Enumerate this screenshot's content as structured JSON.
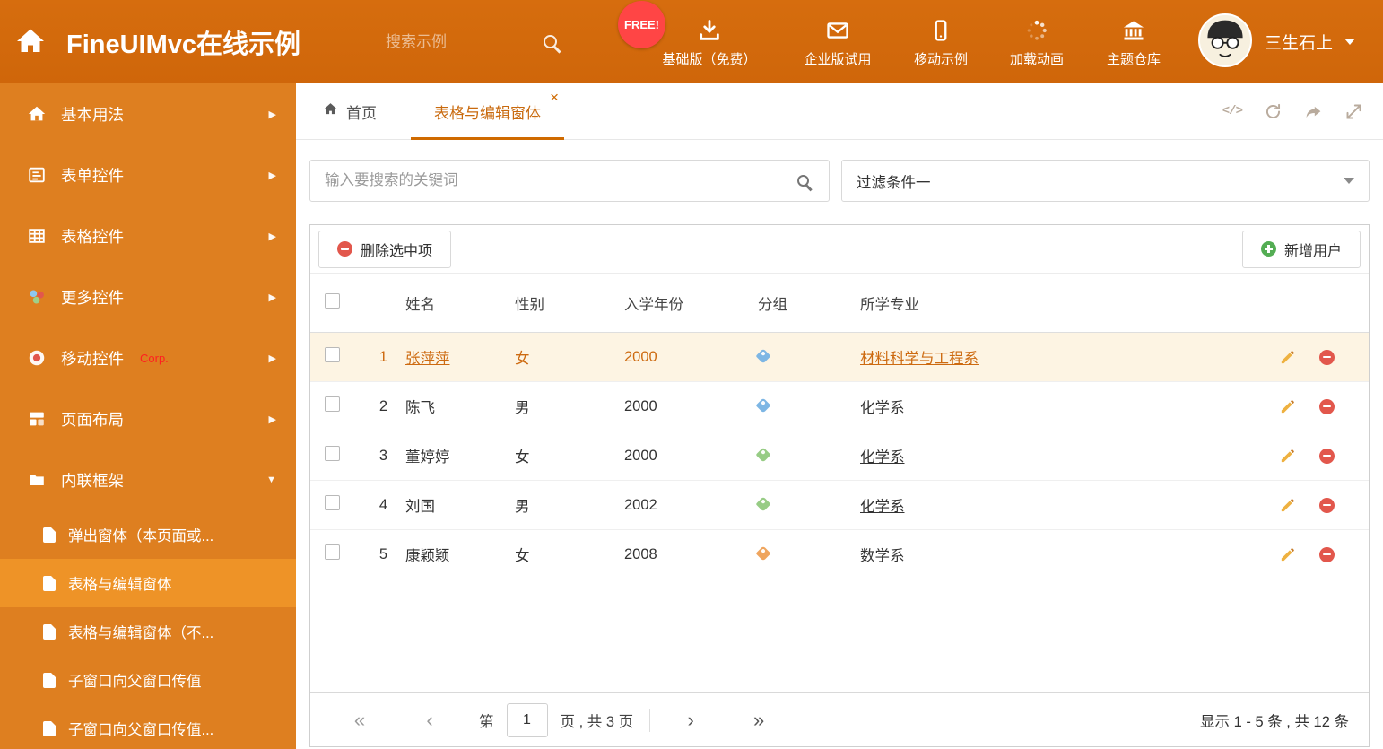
{
  "colors": {
    "header_bg": "#d2690b",
    "sidebar_bg": "#de7f20",
    "sidebar_active_bg": "#ee9327",
    "accent": "#cd6a10",
    "row_highlight_bg": "#fdf4e3",
    "danger": "#e2574c",
    "success": "#54ad54",
    "free_badge_bg": "#ff4545",
    "tag_blue": "#7db6e4",
    "tag_green": "#97cc85",
    "tag_orange": "#efa55e"
  },
  "header": {
    "title": "FineUIMvc在线示例",
    "search_placeholder": "搜索示例",
    "free_badge": "FREE!",
    "nav_items": [
      {
        "label": "基础版（免费）",
        "icon": "download-icon"
      },
      {
        "label": "企业版试用",
        "icon": "envelope-icon"
      },
      {
        "label": "移动示例",
        "icon": "mobile-icon"
      },
      {
        "label": "加载动画",
        "icon": "spinner-icon"
      },
      {
        "label": "主题仓库",
        "icon": "bank-icon"
      }
    ],
    "user_name": "三生石上"
  },
  "sidebar": {
    "items": [
      {
        "label": "基本用法",
        "icon": "home-icon"
      },
      {
        "label": "表单控件",
        "icon": "form-icon"
      },
      {
        "label": "表格控件",
        "icon": "table-icon"
      },
      {
        "label": "更多控件",
        "icon": "widgets-icon"
      },
      {
        "label": "移动控件",
        "badge": "Corp.",
        "icon": "mobile-icon"
      },
      {
        "label": "页面布局",
        "icon": "layout-icon"
      },
      {
        "label": "内联框架",
        "icon": "folder-icon",
        "expanded": true
      }
    ],
    "subitems": [
      {
        "label": "弹出窗体（本页面或..."
      },
      {
        "label": "表格与编辑窗体",
        "active": true
      },
      {
        "label": "表格与编辑窗体（不..."
      },
      {
        "label": "子窗口向父窗口传值"
      },
      {
        "label": "子窗口向父窗口传值..."
      }
    ]
  },
  "tabs": {
    "home_label": "首页",
    "active_label": "表格与编辑窗体"
  },
  "filterbar": {
    "search_placeholder": "输入要搜索的关键词",
    "filter_selected": "过滤条件一"
  },
  "toolbar": {
    "delete_label": "删除选中项",
    "add_label": "新增用户"
  },
  "table": {
    "headers": {
      "name": "姓名",
      "gender": "性别",
      "year": "入学年份",
      "group": "分组",
      "major": "所学专业"
    },
    "rows": [
      {
        "num": "1",
        "name": "张萍萍",
        "gender": "女",
        "year": "2000",
        "tag_color": "#7db6e4",
        "major": "材料科学与工程系",
        "highlight": true
      },
      {
        "num": "2",
        "name": "陈飞",
        "gender": "男",
        "year": "2000",
        "tag_color": "#7db6e4",
        "major": "化学系",
        "highlight": false
      },
      {
        "num": "3",
        "name": "董婷婷",
        "gender": "女",
        "year": "2000",
        "tag_color": "#97cc85",
        "major": "化学系",
        "highlight": false
      },
      {
        "num": "4",
        "name": "刘国",
        "gender": "男",
        "year": "2002",
        "tag_color": "#97cc85",
        "major": "化学系",
        "highlight": false
      },
      {
        "num": "5",
        "name": "康颖颖",
        "gender": "女",
        "year": "2008",
        "tag_color": "#efa55e",
        "major": "数学系",
        "highlight": false
      }
    ]
  },
  "pagination": {
    "page_prefix": "第",
    "page_value": "1",
    "page_suffix": "页 , 共 3 页",
    "summary": "显示 1 - 5 条 , 共 12 条"
  }
}
